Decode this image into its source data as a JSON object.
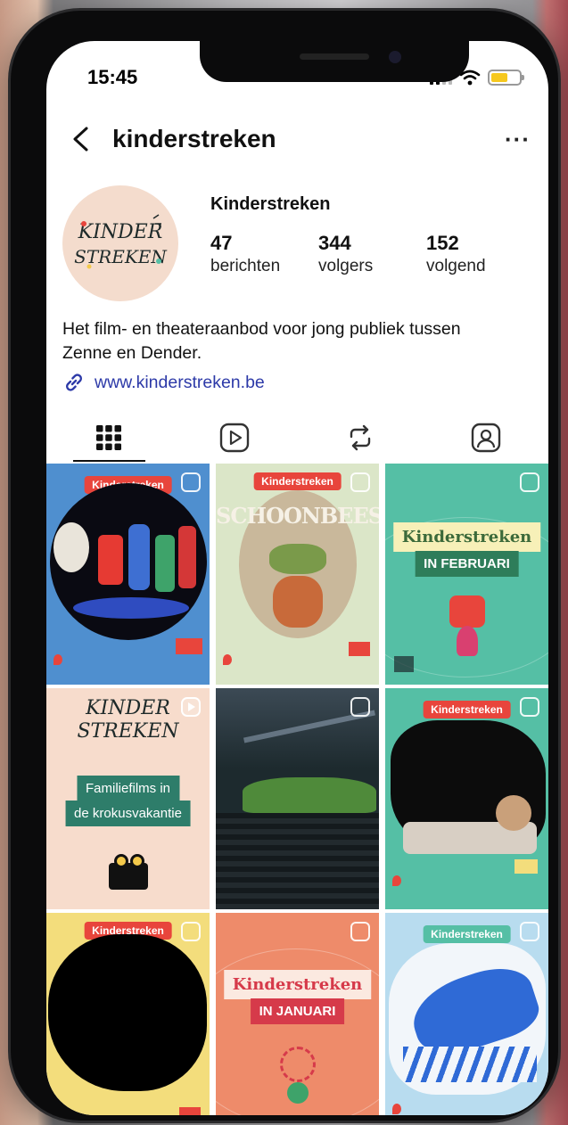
{
  "status": {
    "time": "15:45"
  },
  "header": {
    "username": "kinderstreken",
    "more_label": "···"
  },
  "profile": {
    "display_name": "Kinderstreken",
    "avatar_text_1": "KINDER",
    "avatar_text_2": "STREKEN",
    "stats": [
      {
        "value": "47",
        "label": "berichten"
      },
      {
        "value": "344",
        "label": "volgers"
      },
      {
        "value": "152",
        "label": "volgend"
      }
    ],
    "bio_line_1": "Het film- en theateraanbod voor jong publiek tussen",
    "bio_line_2": "Zenne en Dender.",
    "website": "www.kinderstreken.be"
  },
  "tabs": [
    {
      "icon": "grid-icon",
      "active": true
    },
    {
      "icon": "reels-icon",
      "active": false
    },
    {
      "icon": "repost-icon",
      "active": false
    },
    {
      "icon": "tagged-icon",
      "active": false
    }
  ],
  "posts": {
    "p1": {
      "tag": "Kinderstreken"
    },
    "p2": {
      "tag": "Kinderstreken",
      "title": "SCHOONBEEST"
    },
    "p3": {
      "title_1": "Kinderstreken",
      "title_2": "IN FEBRUARI"
    },
    "p4": {
      "logo_1": "KINDER",
      "logo_2": "STREKEN",
      "title_1": "Familiefilms in",
      "title_2": "de krokusvakantie"
    },
    "p6": {
      "tag": "Kinderstreken"
    },
    "p7": {
      "tag": "Kinderstreken"
    },
    "p8": {
      "title_1": "Kinderstreken",
      "title_2": "IN JANUARI"
    },
    "p9": {
      "tag": "Kinderstreken"
    }
  },
  "colors": {
    "link": "#2d3aa8",
    "tag_red": "#e8453c",
    "teal": "#55bfa5",
    "battery": "#f6c81e"
  }
}
